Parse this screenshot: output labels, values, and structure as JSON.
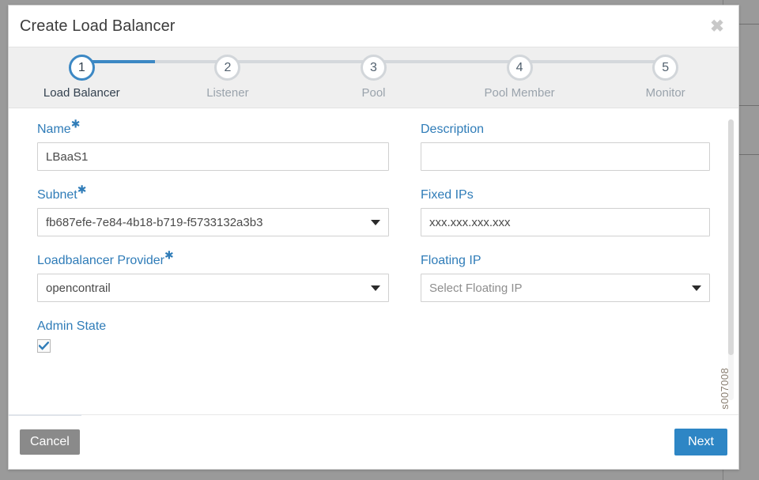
{
  "modal": {
    "title": "Create Load Balancer",
    "close_icon": "close-icon",
    "close_label": "✖"
  },
  "stepper": {
    "active_index": 0,
    "active_color": "#3c88c4",
    "inactive_color": "#d2d6da",
    "steps": [
      {
        "number": "1",
        "label": "Load Balancer"
      },
      {
        "number": "2",
        "label": "Listener"
      },
      {
        "number": "3",
        "label": "Pool"
      },
      {
        "number": "4",
        "label": "Pool Member"
      },
      {
        "number": "5",
        "label": "Monitor"
      }
    ]
  },
  "form": {
    "name": {
      "label": "Name",
      "required": true,
      "value": "LBaaS1",
      "placeholder": ""
    },
    "description": {
      "label": "Description",
      "required": false,
      "value": "",
      "placeholder": ""
    },
    "subnet": {
      "label": "Subnet",
      "required": true,
      "value": "fb687efe-7e84-4b18-b719-f5733132a3b3",
      "is_placeholder": false
    },
    "fixed_ips": {
      "label": "Fixed IPs",
      "required": false,
      "value": "xxx.xxx.xxx.xxx",
      "placeholder": "xxx.xxx.xxx.xxx"
    },
    "loadbalancer_provider": {
      "label": "Loadbalancer Provider",
      "required": true,
      "value": "opencontrail",
      "is_placeholder": false
    },
    "floating_ip": {
      "label": "Floating IP",
      "required": false,
      "value": "Select Floating IP",
      "is_placeholder": true
    },
    "admin_state": {
      "label": "Admin State",
      "required": false,
      "checked": true
    }
  },
  "footer": {
    "cancel_label": "Cancel",
    "next_label": "Next"
  },
  "figure_reference": "s007008",
  "colors": {
    "accent_blue": "#2e86c5",
    "label_blue": "#2f7cb8",
    "cancel_gray": "#8a8a8a",
    "stepper_band": "#efefef",
    "page_background": "#9a9a9a"
  }
}
